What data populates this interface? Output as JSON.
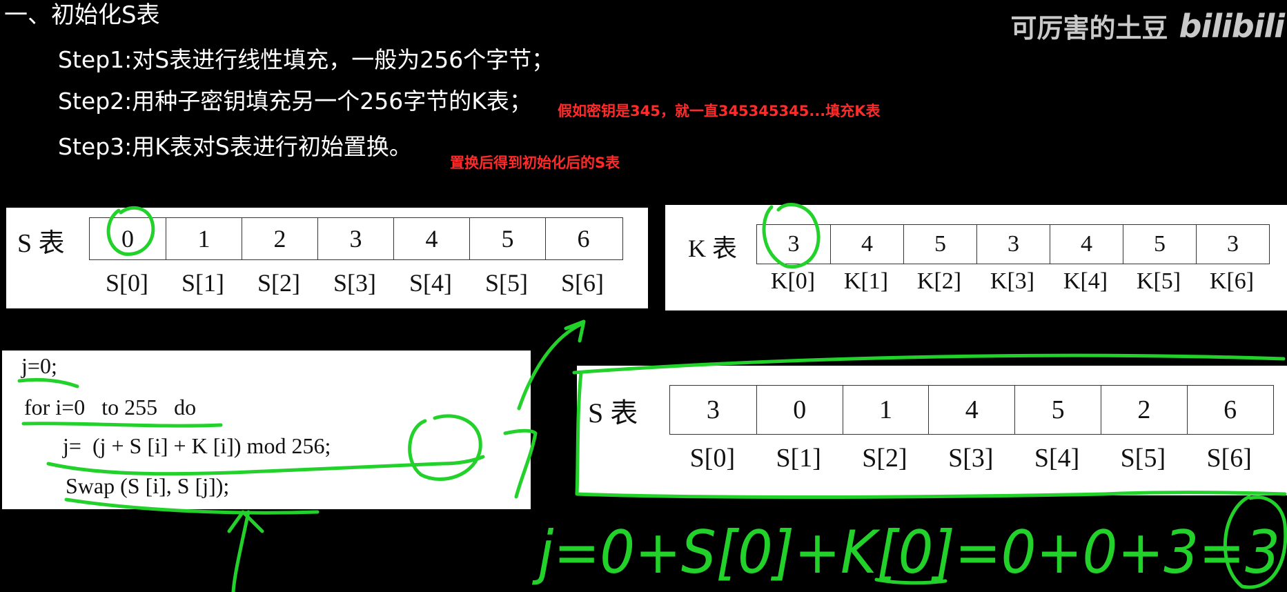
{
  "header": {
    "title": "一、初始化S表",
    "steps": [
      "Step1:对S表进行线性填充，一般为256个字节；",
      "Step2:用种子密钥填充另一个256字节的K表；",
      "Step3:用K表对S表进行初始置换。"
    ],
    "note_key": "假如密钥是345，就一直345345345...填充K表",
    "note_result": "置换后得到初始化后的S表"
  },
  "brand": {
    "uploader": "可厉害的土豆",
    "logo": "bilibili"
  },
  "s_table": {
    "label": "S 表",
    "values": [
      "0",
      "1",
      "2",
      "3",
      "4",
      "5",
      "6"
    ],
    "indices": [
      "S[0]",
      "S[1]",
      "S[2]",
      "S[3]",
      "S[4]",
      "S[5]",
      "S[6]"
    ]
  },
  "k_table": {
    "label": "K 表",
    "values": [
      "3",
      "4",
      "5",
      "3",
      "4",
      "5",
      "3"
    ],
    "indices": [
      "K[0]",
      "K[1]",
      "K[2]",
      "K[3]",
      "K[4]",
      "K[5]",
      "K[6]"
    ]
  },
  "s_table_result": {
    "label": "S 表",
    "values": [
      "3",
      "0",
      "1",
      "4",
      "5",
      "2",
      "6"
    ],
    "indices": [
      "S[0]",
      "S[1]",
      "S[2]",
      "S[3]",
      "S[4]",
      "S[5]",
      "S[6]"
    ]
  },
  "code": {
    "lines": [
      "j=0;",
      "for i=0   to 255   do",
      "j=  (j + S [i] + K [i]) mod 256;",
      "Swap (S [i], S [j]);"
    ]
  },
  "handwriting": "j=0+S[0]+K[0]=0+0+3=3",
  "colors": {
    "background": "#000000",
    "annotation_red": "#ff2a2a",
    "ink_green": "#22d12a",
    "panel": "#ffffff"
  }
}
